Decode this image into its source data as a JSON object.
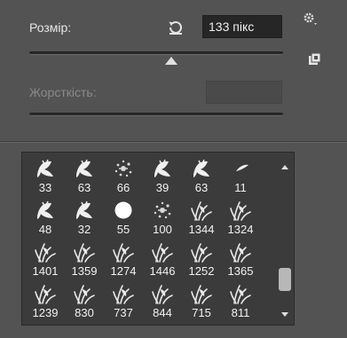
{
  "size": {
    "label": "Розмір:",
    "value": "133 пікс",
    "slider_fraction": 0.56
  },
  "hardness": {
    "label": "Жорсткість:",
    "disabled": true
  },
  "icons": {
    "reset": "reset-icon",
    "settings": "gear-icon",
    "new_preset": "new-preset-icon"
  },
  "brushes": [
    {
      "label": "33",
      "kind": "leaf"
    },
    {
      "label": "63",
      "kind": "leaf"
    },
    {
      "label": "66",
      "kind": "splatter"
    },
    {
      "label": "39",
      "kind": "leaf"
    },
    {
      "label": "63",
      "kind": "leaf"
    },
    {
      "label": "11",
      "kind": "stroke"
    },
    {
      "label": "48",
      "kind": "leaf"
    },
    {
      "label": "32",
      "kind": "leaf"
    },
    {
      "label": "55",
      "kind": "round"
    },
    {
      "label": "100",
      "kind": "splatter"
    },
    {
      "label": "1344",
      "kind": "grass"
    },
    {
      "label": "1324",
      "kind": "grass"
    },
    {
      "label": "1401",
      "kind": "grass"
    },
    {
      "label": "1359",
      "kind": "grass"
    },
    {
      "label": "1274",
      "kind": "grass"
    },
    {
      "label": "1446",
      "kind": "grass"
    },
    {
      "label": "1252",
      "kind": "grass"
    },
    {
      "label": "1365",
      "kind": "grass"
    },
    {
      "label": "1239",
      "kind": "grass"
    },
    {
      "label": "830",
      "kind": "grass"
    },
    {
      "label": "737",
      "kind": "grass"
    },
    {
      "label": "844",
      "kind": "grass"
    },
    {
      "label": "715",
      "kind": "grass"
    },
    {
      "label": "811",
      "kind": "grass"
    }
  ],
  "colors": {
    "panel_bg": "#535353",
    "grid_bg": "#3b3b3b",
    "text": "#e6e6e6",
    "disabled_text": "#8a8a8a"
  }
}
